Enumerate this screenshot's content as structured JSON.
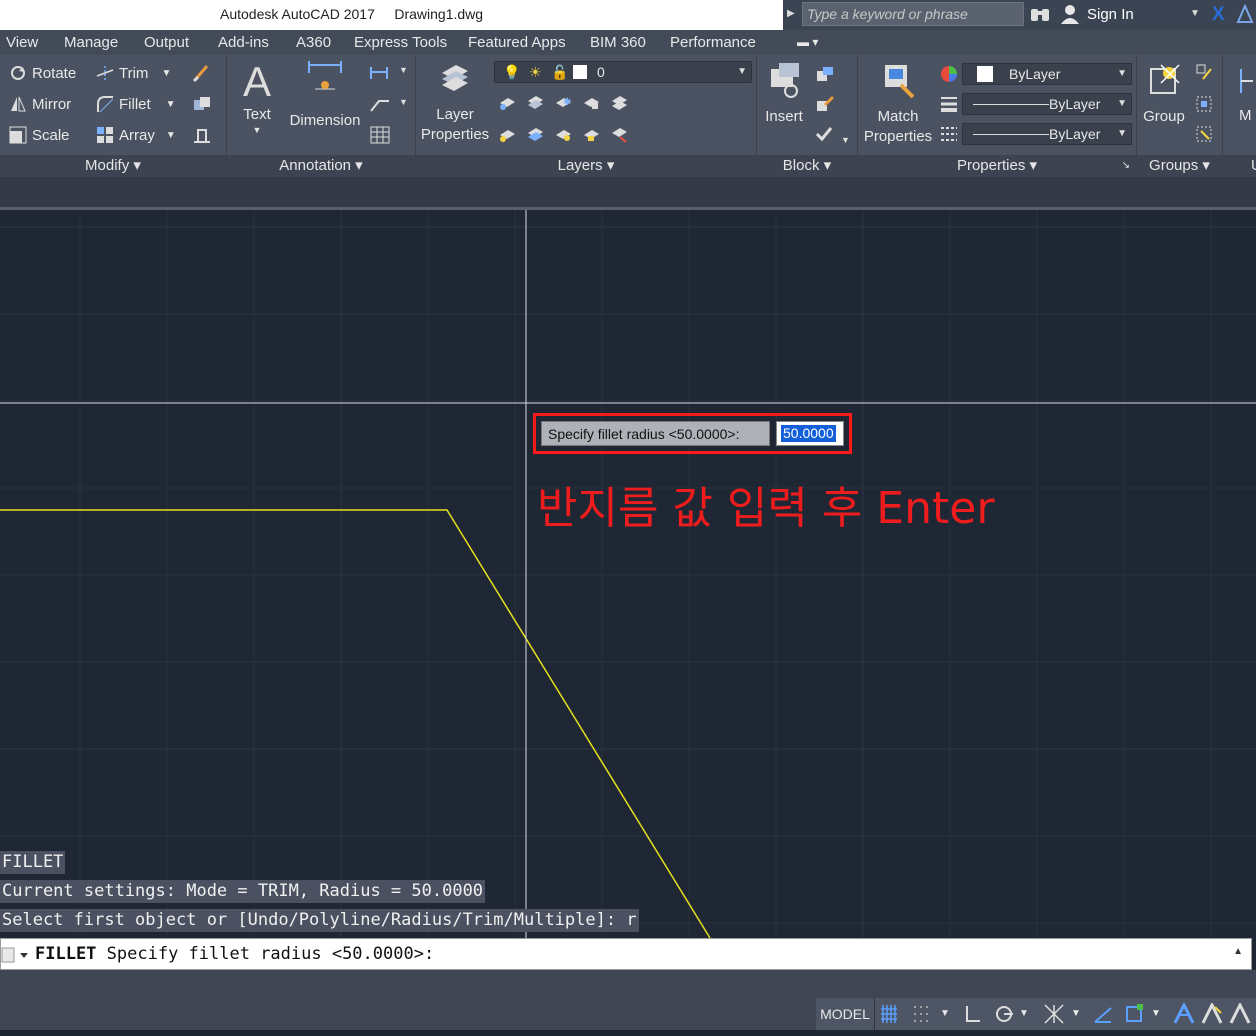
{
  "title_bar": {
    "app_name": "Autodesk AutoCAD 2017",
    "document": "Drawing1.dwg",
    "search_placeholder": "Type a keyword or phrase",
    "sign_in": "Sign In"
  },
  "menu_tabs": [
    "View",
    "Manage",
    "Output",
    "Add-ins",
    "A360",
    "Express Tools",
    "Featured Apps",
    "BIM 360",
    "Performance"
  ],
  "ribbon": {
    "modify": {
      "title": "Modify",
      "rotate": "Rotate",
      "trim": "Trim",
      "mirror": "Mirror",
      "fillet": "Fillet",
      "scale": "Scale",
      "array": "Array"
    },
    "annotation": {
      "title": "Annotation",
      "text": "Text",
      "dimension": "Dimension"
    },
    "layers": {
      "title": "Layers",
      "layer_properties_line1": "Layer",
      "layer_properties_line2": "Properties",
      "current_layer": "0"
    },
    "block": {
      "title": "Block",
      "insert": "Insert"
    },
    "properties": {
      "title": "Properties",
      "match_line1": "Match",
      "match_line2": "Properties",
      "color": "ByLayer",
      "linetype": "ByLayer",
      "lineweight": "ByLayer"
    },
    "groups": {
      "title": "Groups",
      "group": "Group"
    },
    "partial_label": "M"
  },
  "fillet_prompt": {
    "label": "Specify fillet radius <50.0000>:",
    "value": "50.0000"
  },
  "annotation_text": "반지름 값 입력 후 Enter",
  "command_history": [
    "FILLET",
    "Current settings: Mode = TRIM, Radius = 50.0000",
    "Select first object or [Undo/Polyline/Radius/Trim/Multiple]: r"
  ],
  "command_line": {
    "command": "FILLET",
    "prompt": "Specify fillet radius <50.0000>:"
  },
  "status_bar": {
    "model": "MODEL"
  },
  "colors": {
    "canvas_bg": "#1f2634",
    "drawing_line": "#e6e01e",
    "highlight_red": "#ff1a1a"
  }
}
